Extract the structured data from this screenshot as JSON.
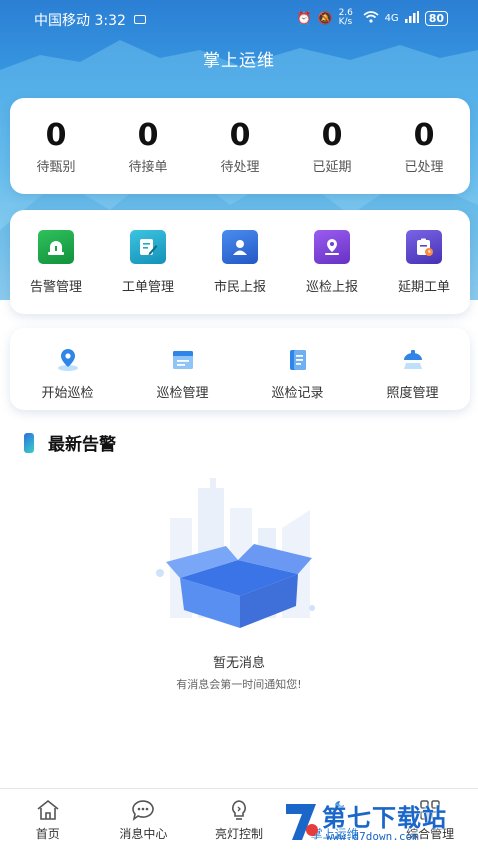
{
  "status_bar": {
    "carrier": "中国移动",
    "time": "3:32",
    "network_speed": "2.6 K/s",
    "signal": "4G",
    "battery": "80"
  },
  "app": {
    "title": "掌上运维"
  },
  "stats": [
    {
      "value": "0",
      "label": "待甄别"
    },
    {
      "value": "0",
      "label": "待接单"
    },
    {
      "value": "0",
      "label": "待处理"
    },
    {
      "value": "0",
      "label": "已延期"
    },
    {
      "value": "0",
      "label": "已处理"
    }
  ],
  "main_menu": [
    {
      "label": "告警管理",
      "icon": "alarm-light-icon",
      "color": "#1aa34a"
    },
    {
      "label": "工单管理",
      "icon": "edit-document-icon",
      "color": "#22a7c9"
    },
    {
      "label": "市民上报",
      "icon": "citizen-report-icon",
      "color": "#2e6fd6"
    },
    {
      "label": "巡检上报",
      "icon": "location-report-icon",
      "color": "#7a3fd6"
    },
    {
      "label": "延期工单",
      "icon": "delay-clipboard-icon",
      "color": "#5a45c9"
    }
  ],
  "inspection_menu": [
    {
      "label": "开始巡检",
      "icon": "location-pin-icon"
    },
    {
      "label": "巡检管理",
      "icon": "folder-manage-icon"
    },
    {
      "label": "巡检记录",
      "icon": "notebook-icon"
    },
    {
      "label": "照度管理",
      "icon": "lamp-icon"
    }
  ],
  "alerts_section": {
    "title": "最新告警",
    "empty_title": "暂无消息",
    "empty_subtitle": "有消息会第一时间通知您!"
  },
  "tabbar": [
    {
      "label": "首页",
      "icon": "home-icon"
    },
    {
      "label": "消息中心",
      "icon": "chat-icon"
    },
    {
      "label": "亮灯控制",
      "icon": "bulb-icon"
    },
    {
      "label": "掌上运维",
      "icon": "wrench-icon"
    },
    {
      "label": "综合管理",
      "icon": "grid-icon"
    }
  ],
  "watermark": {
    "text": "第七下载站",
    "url": "www.d7down.com"
  }
}
